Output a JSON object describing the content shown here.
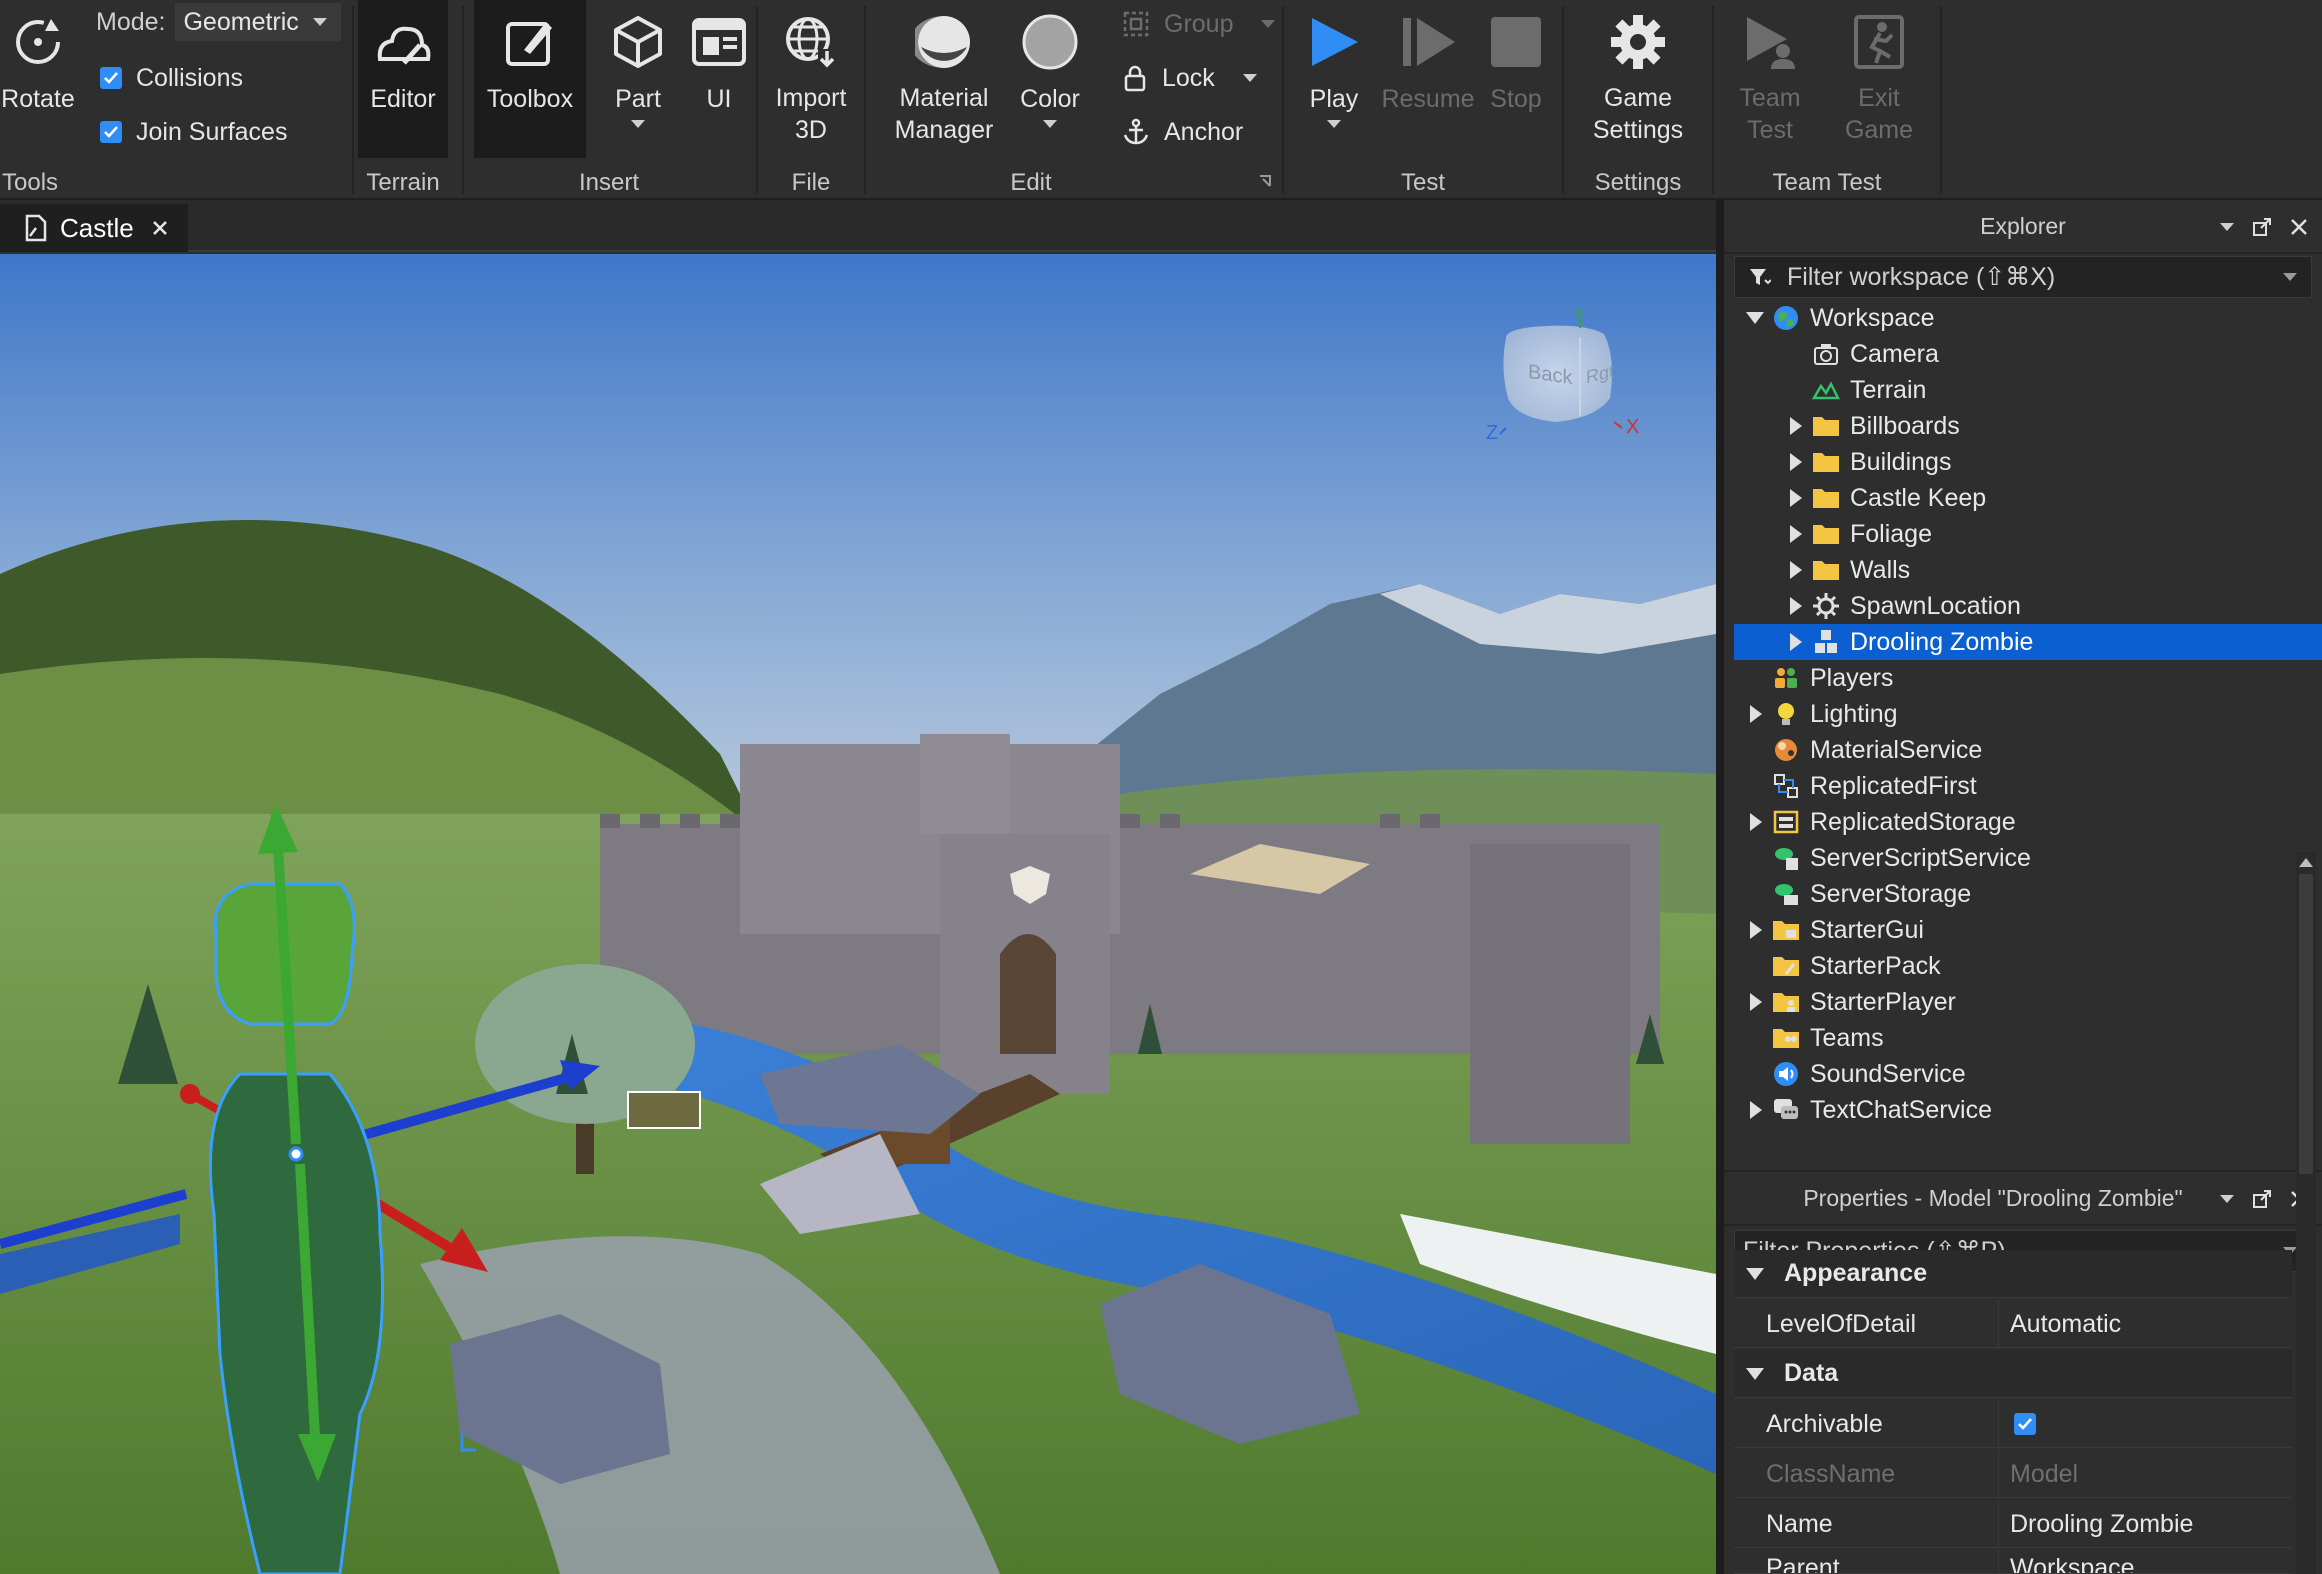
{
  "ribbon": {
    "tools": {
      "rotate_label": "Rotate",
      "mode_label": "Mode:",
      "mode_value": "Geometric",
      "collisions_label": "Collisions",
      "join_surfaces_label": "Join Surfaces",
      "group_label": "Tools"
    },
    "terrain": {
      "editor_label": "Editor",
      "group_label": "Terrain"
    },
    "insert": {
      "toolbox_label": "Toolbox",
      "part_label": "Part",
      "ui_label": "UI",
      "group_label": "Insert"
    },
    "file": {
      "import_line1": "Import",
      "import_line2": "3D",
      "group_label": "File"
    },
    "edit": {
      "material_line1": "Material",
      "material_line2": "Manager",
      "color_label": "Color",
      "group_label": "Group",
      "lock_label": "Lock",
      "anchor_label": "Anchor",
      "section_label": "Edit"
    },
    "test": {
      "play_label": "Play",
      "resume_label": "Resume",
      "stop_label": "Stop",
      "group_label": "Test"
    },
    "settings": {
      "game_line1": "Game",
      "game_line2": "Settings",
      "group_label": "Settings"
    },
    "team_test": {
      "team_line1": "Team",
      "team_line2": "Test",
      "exit_line1": "Exit",
      "exit_line2": "Game",
      "group_label": "Team Test"
    }
  },
  "tabs": {
    "document_tab": "Castle"
  },
  "viewport": {
    "view_cube": {
      "back_label": "Back",
      "right_label": "Rgt",
      "z_label": "Z",
      "x_label": "X",
      "y_label": "Y"
    }
  },
  "explorer": {
    "title": "Explorer",
    "filter_placeholder": "Filter workspace (⇧⌘X)",
    "items": [
      {
        "label": "Workspace",
        "depth": 0,
        "arrow": "down",
        "icon": "workspace-icon"
      },
      {
        "label": "Camera",
        "depth": 1,
        "arrow": "none",
        "icon": "camera-icon"
      },
      {
        "label": "Terrain",
        "depth": 1,
        "arrow": "none",
        "icon": "terrain-icon"
      },
      {
        "label": "Billboards",
        "depth": 1,
        "arrow": "right",
        "icon": "folder-icon"
      },
      {
        "label": "Buildings",
        "depth": 1,
        "arrow": "right",
        "icon": "folder-icon"
      },
      {
        "label": "Castle Keep",
        "depth": 1,
        "arrow": "right",
        "icon": "folder-icon"
      },
      {
        "label": "Foliage",
        "depth": 1,
        "arrow": "right",
        "icon": "folder-icon"
      },
      {
        "label": "Walls",
        "depth": 1,
        "arrow": "right",
        "icon": "folder-icon"
      },
      {
        "label": "SpawnLocation",
        "depth": 1,
        "arrow": "right",
        "icon": "spawn-icon"
      },
      {
        "label": "Drooling Zombie",
        "depth": 1,
        "arrow": "right",
        "icon": "model-icon",
        "selected": true
      },
      {
        "label": "Players",
        "depth": 0,
        "arrow": "none",
        "icon": "players-icon"
      },
      {
        "label": "Lighting",
        "depth": 0,
        "arrow": "right",
        "icon": "lighting-icon"
      },
      {
        "label": "MaterialService",
        "depth": 0,
        "arrow": "none",
        "icon": "material-service-icon"
      },
      {
        "label": "ReplicatedFirst",
        "depth": 0,
        "arrow": "none",
        "icon": "replicated-first-icon"
      },
      {
        "label": "ReplicatedStorage",
        "depth": 0,
        "arrow": "right",
        "icon": "replicated-storage-icon"
      },
      {
        "label": "ServerScriptService",
        "depth": 0,
        "arrow": "none",
        "icon": "server-script-icon"
      },
      {
        "label": "ServerStorage",
        "depth": 0,
        "arrow": "none",
        "icon": "server-storage-icon"
      },
      {
        "label": "StarterGui",
        "depth": 0,
        "arrow": "right",
        "icon": "starter-gui-icon"
      },
      {
        "label": "StarterPack",
        "depth": 0,
        "arrow": "none",
        "icon": "starter-pack-icon"
      },
      {
        "label": "StarterPlayer",
        "depth": 0,
        "arrow": "right",
        "icon": "starter-player-icon"
      },
      {
        "label": "Teams",
        "depth": 0,
        "arrow": "none",
        "icon": "teams-icon"
      },
      {
        "label": "SoundService",
        "depth": 0,
        "arrow": "none",
        "icon": "sound-icon"
      },
      {
        "label": "TextChatService",
        "depth": 0,
        "arrow": "right",
        "icon": "chat-icon"
      }
    ]
  },
  "properties": {
    "title": "Properties - Model \"Drooling Zombie\"",
    "filter_placeholder": "Filter Properties (⇧⌘P)",
    "sections": {
      "appearance": "Appearance",
      "data": "Data"
    },
    "rows": {
      "level_of_detail": {
        "name": "LevelOfDetail",
        "value": "Automatic"
      },
      "archivable": {
        "name": "Archivable",
        "checked": true
      },
      "class_name": {
        "name": "ClassName",
        "value": "Model"
      },
      "name": {
        "name": "Name",
        "value": "Drooling Zombie"
      },
      "parent": {
        "name": "Parent",
        "value": "Workspace"
      }
    }
  },
  "colors": {
    "accent": "#0b5fd1",
    "play": "#2f8df5",
    "folder": "#f4c542"
  }
}
